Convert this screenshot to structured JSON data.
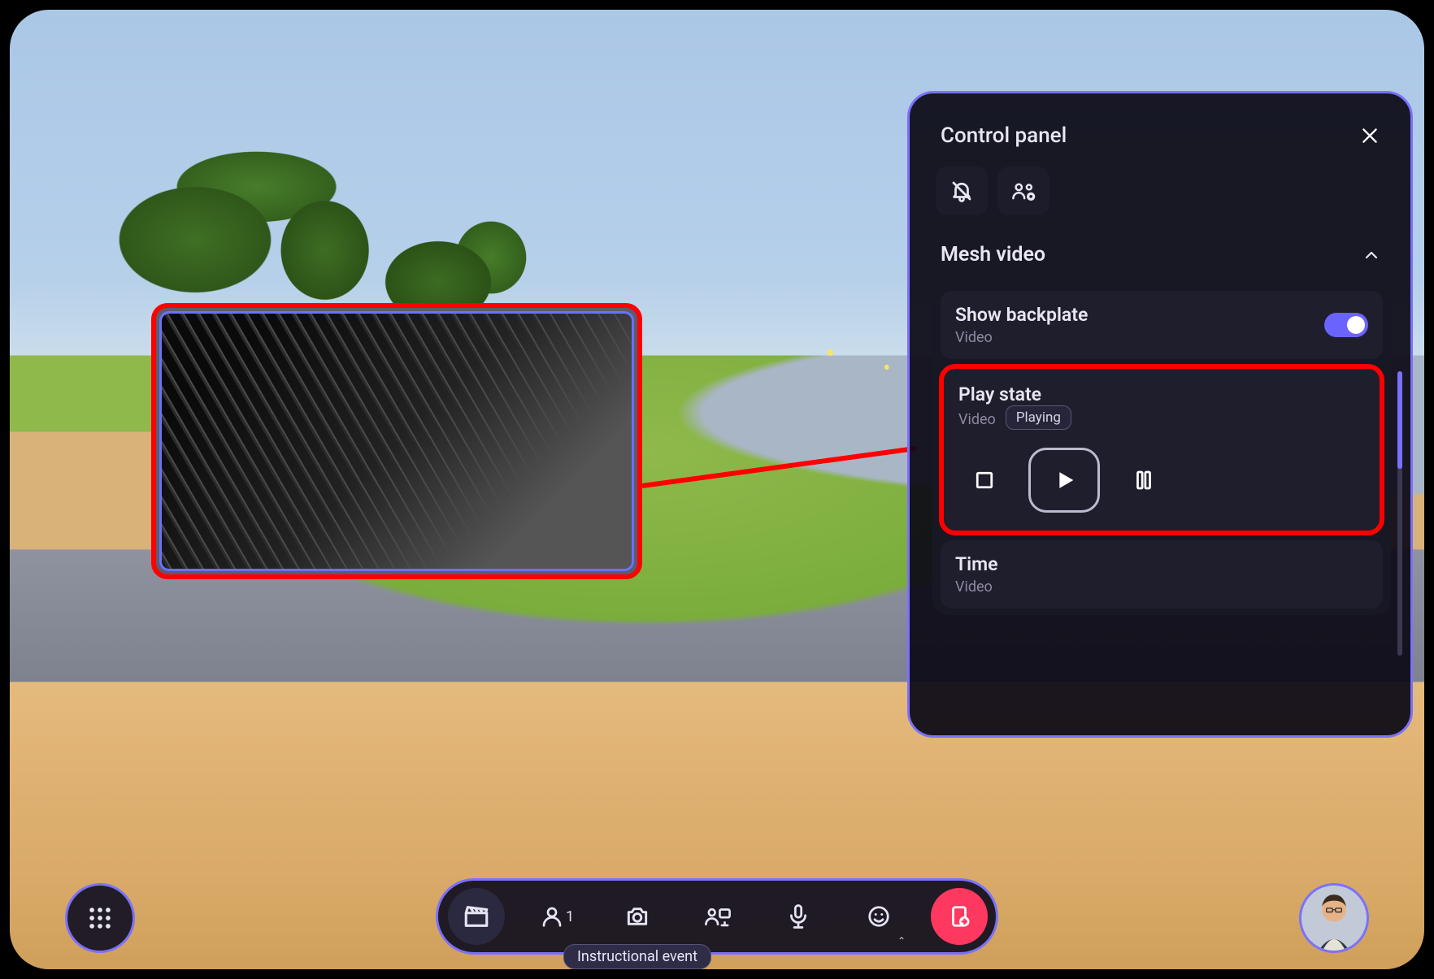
{
  "panel": {
    "title": "Control panel",
    "section_title": "Mesh video",
    "backplate": {
      "label": "Show backplate",
      "sublabel": "Video",
      "enabled": true
    },
    "playstate": {
      "label": "Play state",
      "sublabel": "Video",
      "badge": "Playing"
    },
    "time": {
      "label": "Time",
      "sublabel": "Video"
    }
  },
  "dock": {
    "people_count": "1",
    "tooltip": "Instructional event"
  },
  "colors": {
    "accent": "#7a71ff",
    "danger": "#ff0000",
    "leave": "#ff3860"
  }
}
